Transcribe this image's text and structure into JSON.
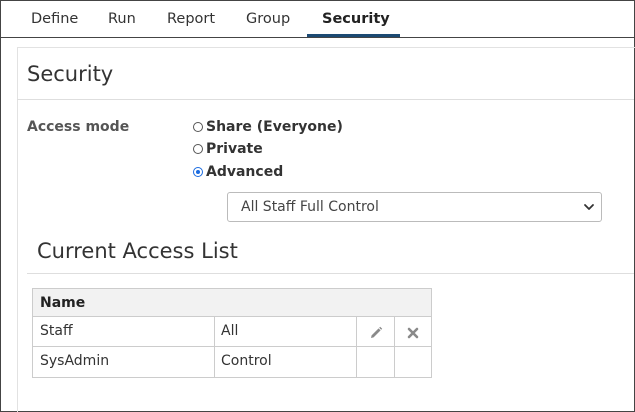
{
  "tabs": [
    {
      "label": "Define"
    },
    {
      "label": "Run"
    },
    {
      "label": "Report"
    },
    {
      "label": "Group"
    },
    {
      "label": "Security",
      "active": true
    }
  ],
  "panel": {
    "title": "Security"
  },
  "access_mode": {
    "label": "Access mode",
    "options": [
      {
        "label": "Share (Everyone)",
        "checked": false
      },
      {
        "label": "Private",
        "checked": false
      },
      {
        "label": "Advanced",
        "checked": true
      }
    ],
    "selected_profile": "All Staff Full Control"
  },
  "access_list": {
    "title": "Current Access List",
    "header": "Name",
    "rows": [
      {
        "name": "Staff",
        "permission": "All",
        "actions": [
          "pencil-icon",
          "delete-x-icon"
        ]
      },
      {
        "name": "SysAdmin",
        "permission": "Control",
        "actions": []
      }
    ]
  },
  "colors": {
    "active_tab_underline": "#1c4a73",
    "radio_checked": "#1a6be0",
    "table_header_bg": "#f2f2f2",
    "border": "#444444"
  }
}
